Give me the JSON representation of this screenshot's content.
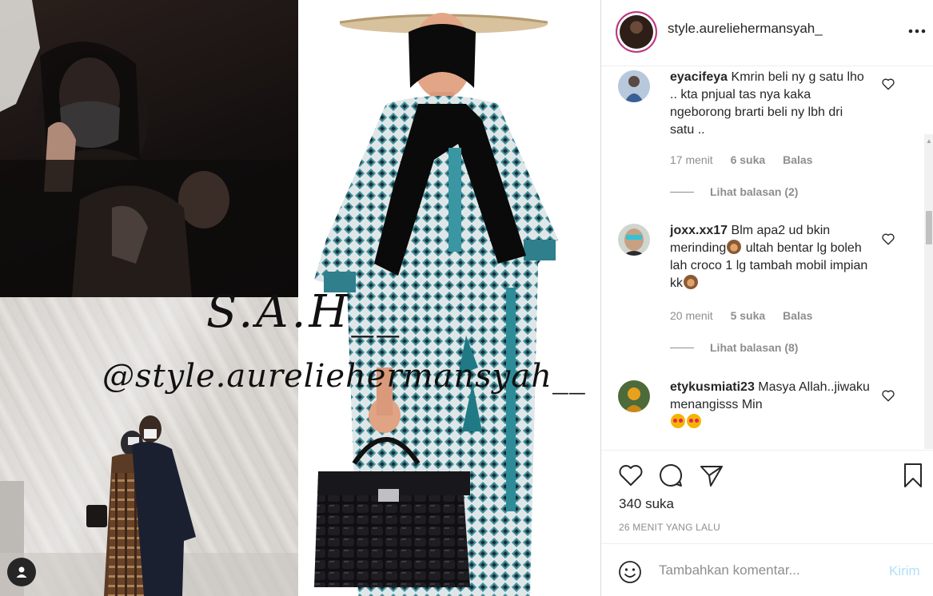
{
  "post": {
    "username": "style.aureliehermansyah_",
    "media": {
      "credit_text": "S.A.H__",
      "handle_watermark": "@style.aureliehermansyah__"
    },
    "likes_text": "340 suka",
    "posted_time": "26 MENIT YANG LALU"
  },
  "comments": [
    {
      "username": "eyacifeya",
      "text": "Kmrin beli ny g satu lho .. kta pnjual tas nya kaka ngeborong brarti beli ny lbh dri satu ..",
      "time": "17 menit",
      "likes": "6 suka",
      "reply": "Balas",
      "view_replies": "Lihat balasan (2)"
    },
    {
      "username": "joxx.xx17",
      "text_before": "Blm apa2 ud bkin merinding",
      "text_middle": " ultah bentar lg boleh lah croco 1 lg tambah mobil impian kk",
      "time": "20 menit",
      "likes": "5 suka",
      "reply": "Balas",
      "view_replies": "Lihat balasan (8)"
    },
    {
      "username": "etykusmiati23",
      "text": "Masya Allah..jiwaku menangisss Min"
    }
  ],
  "comment_box": {
    "placeholder": "Tambahkan komentar...",
    "post_label": "Kirim"
  },
  "icons": {
    "more": "more-options-icon",
    "like": "heart-icon",
    "comment": "comment-bubble-icon",
    "share": "paper-plane-icon",
    "save": "bookmark-icon",
    "emoji": "smiley-icon",
    "user_tag": "user-icon"
  },
  "colors": {
    "text": "#262626",
    "secondary": "#8e8e8e",
    "post_disabled": "#b2dffc",
    "border": "#dbdbdb"
  }
}
